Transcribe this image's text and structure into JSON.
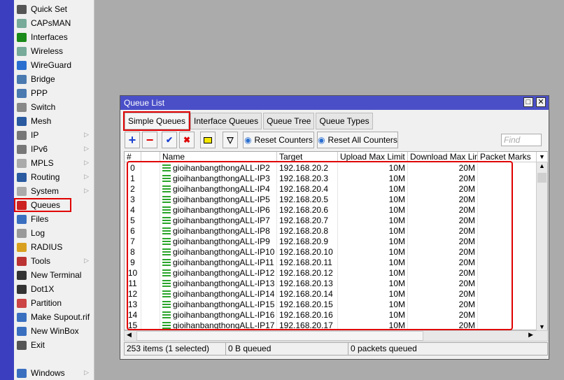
{
  "menu": {
    "items": [
      {
        "label": "Quick Set",
        "icon": "wand-icon",
        "color": "#555"
      },
      {
        "label": "CAPsMAN",
        "icon": "antenna-icon",
        "color": "#7a9"
      },
      {
        "label": "Interfaces",
        "icon": "interface-card-icon",
        "color": "#1a8a1a"
      },
      {
        "label": "Wireless",
        "icon": "antenna-icon",
        "color": "#7a9"
      },
      {
        "label": "WireGuard",
        "icon": "wireguard-icon",
        "color": "#2a6fd0"
      },
      {
        "label": "Bridge",
        "icon": "bridge-icon",
        "color": "#4a7ab0"
      },
      {
        "label": "PPP",
        "icon": "ppp-icon",
        "color": "#4a7ab0"
      },
      {
        "label": "Switch",
        "icon": "switch-icon",
        "color": "#888"
      },
      {
        "label": "Mesh",
        "icon": "mesh-icon",
        "color": "#2a5aa0"
      },
      {
        "label": "IP",
        "icon": "ip-icon",
        "color": "#777",
        "submenu": true
      },
      {
        "label": "IPv6",
        "icon": "ipv6-icon",
        "color": "#777",
        "submenu": true
      },
      {
        "label": "MPLS",
        "icon": "mpls-icon",
        "color": "#aaa",
        "submenu": true
      },
      {
        "label": "Routing",
        "icon": "routing-icon",
        "color": "#2a5aa0",
        "submenu": true
      },
      {
        "label": "System",
        "icon": "gear-icon",
        "color": "#aaa",
        "submenu": true
      },
      {
        "label": "Queues",
        "icon": "queues-icon",
        "color": "#c22",
        "selected": true
      },
      {
        "label": "Files",
        "icon": "folder-icon",
        "color": "#3a6fc0"
      },
      {
        "label": "Log",
        "icon": "log-icon",
        "color": "#999"
      },
      {
        "label": "RADIUS",
        "icon": "radius-icon",
        "color": "#d9a020"
      },
      {
        "label": "Tools",
        "icon": "tools-icon",
        "color": "#b33",
        "submenu": true
      },
      {
        "label": "New Terminal",
        "icon": "terminal-icon",
        "color": "#333"
      },
      {
        "label": "Dot1X",
        "icon": "dot1x-icon",
        "color": "#333"
      },
      {
        "label": "Partition",
        "icon": "partition-icon",
        "color": "#c44"
      },
      {
        "label": "Make Supout.rif",
        "icon": "supout-icon",
        "color": "#3a6fc0"
      },
      {
        "label": "New WinBox",
        "icon": "winbox-icon",
        "color": "#3a6fc0"
      },
      {
        "label": "Exit",
        "icon": "exit-icon",
        "color": "#555"
      }
    ],
    "windows": {
      "label": "Windows",
      "icon": "windows-icon"
    }
  },
  "window": {
    "title": "Queue List",
    "tabs": [
      "Simple Queues",
      "Interface Queues",
      "Queue Tree",
      "Queue Types"
    ],
    "toolbar": {
      "reset_counters": "Reset Counters",
      "reset_all_counters": "Reset All Counters",
      "find_placeholder": "Find"
    },
    "columns": [
      "#",
      "",
      "Name",
      "Target",
      "Upload Max Limit",
      "Download Max Limit",
      "Packet Marks"
    ],
    "rows": [
      [
        "0",
        "gioihanbangthongALL-IP2",
        "192.168.20.2",
        "10M",
        "20M"
      ],
      [
        "1",
        "gioihanbangthongALL-IP3",
        "192.168.20.3",
        "10M",
        "20M"
      ],
      [
        "2",
        "gioihanbangthongALL-IP4",
        "192.168.20.4",
        "10M",
        "20M"
      ],
      [
        "3",
        "gioihanbangthongALL-IP5",
        "192.168.20.5",
        "10M",
        "20M"
      ],
      [
        "4",
        "gioihanbangthongALL-IP6",
        "192.168.20.6",
        "10M",
        "20M"
      ],
      [
        "5",
        "gioihanbangthongALL-IP7",
        "192.168.20.7",
        "10M",
        "20M"
      ],
      [
        "6",
        "gioihanbangthongALL-IP8",
        "192.168.20.8",
        "10M",
        "20M"
      ],
      [
        "7",
        "gioihanbangthongALL-IP9",
        "192.168.20.9",
        "10M",
        "20M"
      ],
      [
        "8",
        "gioihanbangthongALL-IP10",
        "192.168.20.10",
        "10M",
        "20M"
      ],
      [
        "9",
        "gioihanbangthongALL-IP11",
        "192.168.20.11",
        "10M",
        "20M"
      ],
      [
        "10",
        "gioihanbangthongALL-IP12",
        "192.168.20.12",
        "10M",
        "20M"
      ],
      [
        "11",
        "gioihanbangthongALL-IP13",
        "192.168.20.13",
        "10M",
        "20M"
      ],
      [
        "12",
        "gioihanbangthongALL-IP14",
        "192.168.20.14",
        "10M",
        "20M"
      ],
      [
        "13",
        "gioihanbangthongALL-IP15",
        "192.168.20.15",
        "10M",
        "20M"
      ],
      [
        "14",
        "gioihanbangthongALL-IP16",
        "192.168.20.16",
        "10M",
        "20M"
      ],
      [
        "15",
        "gioihanbangthongALL-IP17",
        "192.168.20.17",
        "10M",
        "20M"
      ]
    ],
    "status": [
      "253 items (1 selected)",
      "0 B queued",
      "0 packets queued"
    ]
  }
}
